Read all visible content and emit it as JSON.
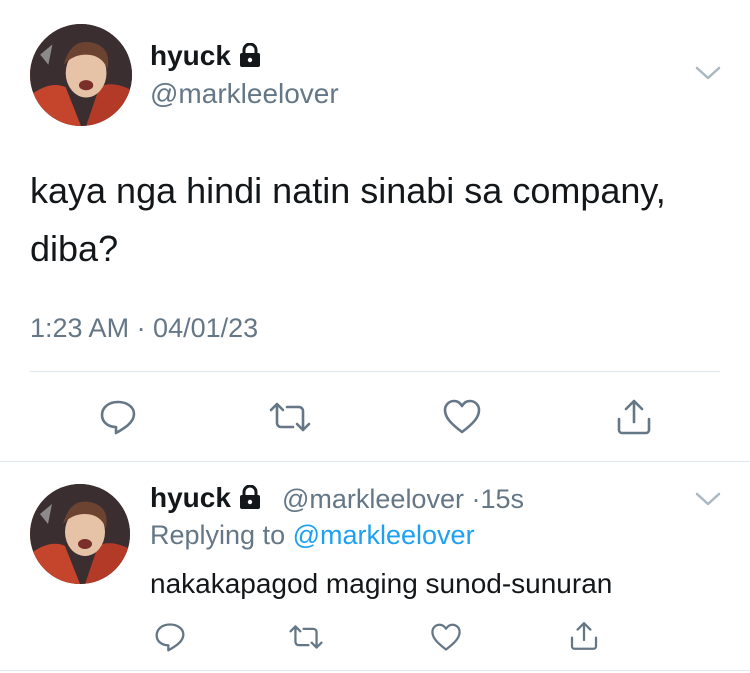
{
  "main_tweet": {
    "display_name": "hyuck",
    "handle": "@markleelover",
    "text": "kaya nga hindi natin sinabi sa company, diba?",
    "timestamp": "1:23 AM · 04/01/23"
  },
  "reply_tweet": {
    "display_name": "hyuck",
    "handle": "@markleelover",
    "separator": "·",
    "time_ago": "15s",
    "replying_prefix": "Replying to",
    "replying_to": "@markleelover",
    "text": "nakakapagod maging sunod-sunuran"
  },
  "icons": [
    "lock-icon",
    "chevron-down-icon",
    "reply-icon",
    "retweet-icon",
    "like-icon",
    "share-icon"
  ],
  "colors": {
    "text": "#14171a",
    "secondary": "#657786",
    "link": "#1da1f2",
    "divider": "#e1e8ed"
  }
}
